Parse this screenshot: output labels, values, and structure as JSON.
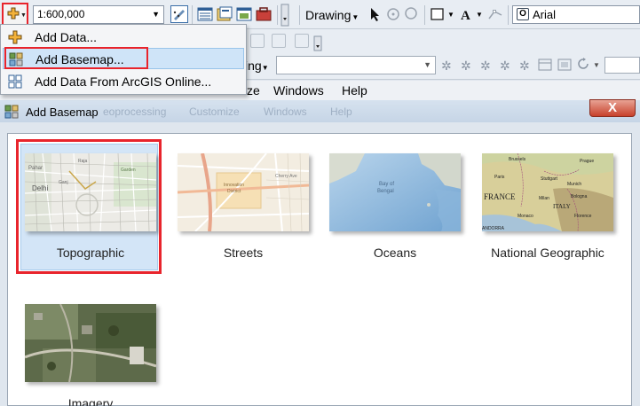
{
  "toolbar": {
    "scale_value": "1:600,000",
    "drawing_label": "Drawing",
    "font_value": "Arial",
    "partial_label": "ing"
  },
  "add_data_menu": {
    "items": [
      {
        "label": "Add Data...",
        "icon": "add-data-icon"
      },
      {
        "label": "Add Basemap...",
        "icon": "basemap-grid-icon",
        "highlighted": true
      },
      {
        "label": "Add Data From ArcGIS Online...",
        "icon": "arcgis-online-grid-icon"
      }
    ]
  },
  "menubar": {
    "items": [
      "ze",
      "Windows",
      "Help"
    ]
  },
  "dialog": {
    "title": "Add Basemap",
    "ghost_menu": [
      "eoprocessing",
      "Customize",
      "Windows",
      "Help"
    ],
    "close_label": "X",
    "basemaps": [
      {
        "label": "Topographic",
        "selected": true
      },
      {
        "label": "Streets",
        "selected": false
      },
      {
        "label": "Oceans",
        "selected": false
      },
      {
        "label": "National Geographic",
        "selected": false
      },
      {
        "label": "Imagery",
        "selected": false
      }
    ]
  },
  "map_labels": {
    "topo": [
      "Delhi",
      "Pahar",
      "Ganj",
      "Raja",
      "Garden"
    ],
    "streets": [
      "Innovation",
      "District",
      "Cherry Ave"
    ],
    "oceans": [
      "Bay of",
      "Bengal"
    ],
    "natgeo": [
      "Brussels",
      "Prague",
      "Paris",
      "FRANCE",
      "Stuttgart",
      "Munich",
      "ITALY",
      "Milan",
      "Monaco",
      "Bologna",
      "Florence",
      "ANDORRA"
    ]
  },
  "colors": {
    "highlight_red": "#e8242c",
    "menu_highlight": "#cfe4f8",
    "selected_tile": "#d3e5f7"
  }
}
